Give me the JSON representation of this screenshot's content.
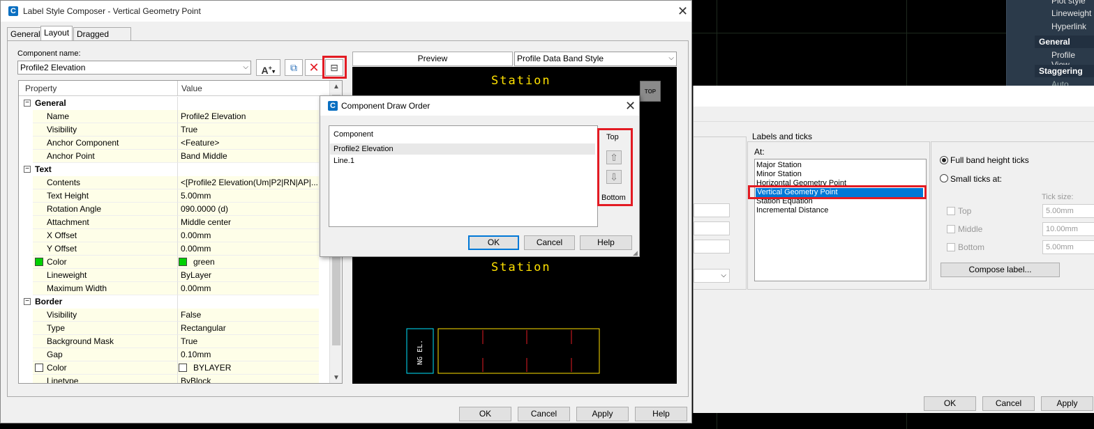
{
  "palette": {
    "items": [
      "Plot style",
      "Lineweight",
      "Hyperlink"
    ],
    "section_general": "General",
    "profile_view": "Profile View",
    "section_staggering": "Staggering",
    "auto_stagger": "Auto stagger"
  },
  "main_dialog": {
    "title": "Label Style Composer - Vertical Geometry Point",
    "tabs": [
      "General",
      "Layout",
      "Dragged State"
    ],
    "component_name_label": "Component name:",
    "component_name_value": "Profile2 Elevation",
    "grid_headers": {
      "property": "Property",
      "value": "Value"
    },
    "rows": [
      {
        "type": "cat",
        "label": "General"
      },
      {
        "type": "prop",
        "label": "Name",
        "value": "Profile2 Elevation"
      },
      {
        "type": "prop",
        "label": "Visibility",
        "value": "True"
      },
      {
        "type": "prop",
        "label": "Anchor Component",
        "value": "<Feature>"
      },
      {
        "type": "prop",
        "label": "Anchor Point",
        "value": "Band Middle"
      },
      {
        "type": "cat",
        "label": "Text"
      },
      {
        "type": "prop",
        "label": "Contents",
        "value": "<[Profile2 Elevation(Um|P2|RN|AP|..."
      },
      {
        "type": "prop",
        "label": "Text Height",
        "value": "5.00mm"
      },
      {
        "type": "prop",
        "label": "Rotation Angle",
        "value": "090.0000 (d)"
      },
      {
        "type": "prop",
        "label": "Attachment",
        "value": "Middle center"
      },
      {
        "type": "prop",
        "label": "X Offset",
        "value": "0.00mm"
      },
      {
        "type": "prop",
        "label": "Y Offset",
        "value": "0.00mm"
      },
      {
        "type": "color",
        "label": "Color",
        "value": "green",
        "swatch": "#00d000"
      },
      {
        "type": "prop",
        "label": "Lineweight",
        "value": "ByLayer"
      },
      {
        "type": "prop",
        "label": "Maximum Width",
        "value": "0.00mm"
      },
      {
        "type": "cat",
        "label": "Border"
      },
      {
        "type": "prop",
        "label": "Visibility",
        "value": "False"
      },
      {
        "type": "prop",
        "label": "Type",
        "value": "Rectangular"
      },
      {
        "type": "prop",
        "label": "Background Mask",
        "value": "True"
      },
      {
        "type": "prop",
        "label": "Gap",
        "value": "0.10mm"
      },
      {
        "type": "color",
        "label": "Color",
        "value": "BYLAYER",
        "swatch": "#ffffff"
      },
      {
        "type": "prop",
        "label": "Linetype",
        "value": "ByBlock"
      }
    ],
    "preview_label": "Preview",
    "preview_style": "Profile Data Band Style",
    "preview_text_top": "Station",
    "preview_text_mid": "Station",
    "preview_vertical_text": "NG EL.",
    "top_button": "TOP",
    "buttons": {
      "ok": "OK",
      "cancel": "Cancel",
      "apply": "Apply",
      "help": "Help"
    }
  },
  "draw_order": {
    "title": "Component Draw Order",
    "header": "Component",
    "items": [
      "Profile2 Elevation",
      "Line.1"
    ],
    "top": "Top",
    "bottom": "Bottom",
    "buttons": {
      "ok": "OK",
      "cancel": "Cancel",
      "help": "Help"
    }
  },
  "bg_dialog": {
    "group_label": "Labels and ticks",
    "at_label": "At:",
    "list": [
      "Major Station",
      "Minor Station",
      "Horizontal Geometry Point",
      "Vertical Geometry Point",
      "Station Equation",
      "Incremental Distance"
    ],
    "radio_full": "Full band height ticks",
    "radio_small": "Small ticks at:",
    "tick_size_label": "Tick size:",
    "ticks": [
      {
        "label": "Top",
        "value": "5.00mm"
      },
      {
        "label": "Middle",
        "value": "10.00mm"
      },
      {
        "label": "Bottom",
        "value": "5.00mm"
      }
    ],
    "compose_label": "Compose label...",
    "buttons": {
      "ok": "OK",
      "cancel": "Cancel",
      "apply": "Apply"
    }
  },
  "colors": {
    "highlight": "#e31b23",
    "selection": "#0078d7",
    "cad_yellow": "#ffe100"
  }
}
